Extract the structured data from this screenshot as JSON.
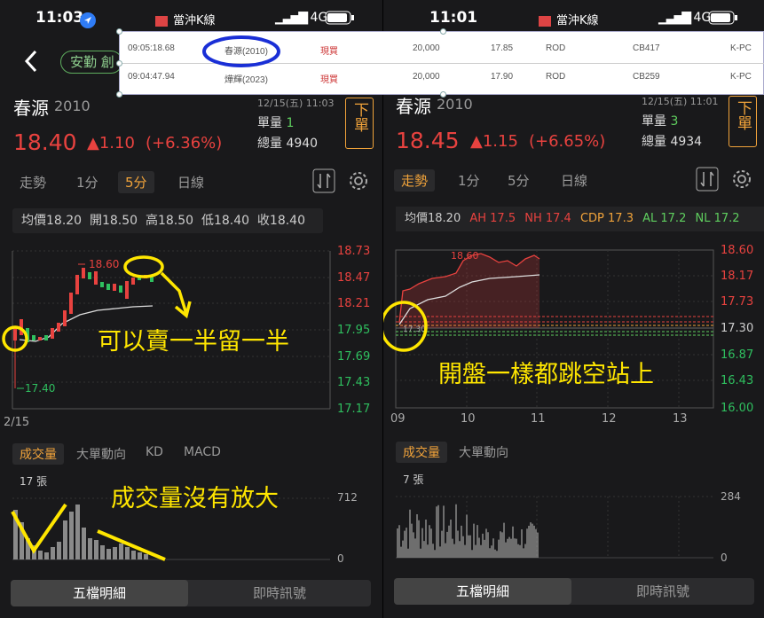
{
  "left": {
    "status_time": "11:03",
    "stock_name": "春源",
    "stock_code": "2010",
    "datetime": "12/15(五) 11:03",
    "unit_label": "單量",
    "unit_value": "1",
    "total_label": "總量",
    "total_value": "4940",
    "price": "18.40",
    "change": "▲1.10",
    "change_pct": "(+6.36%)",
    "order_button": "下單",
    "back_chip": "安勤 創",
    "tabs": [
      "走勢",
      "1分",
      "5分",
      "日線"
    ],
    "active_tab": "5分",
    "stats": "均價18.20  開18.50  高18.50  低18.40  收18.40",
    "y_ticks": [
      "18.73",
      "18.47",
      "18.21",
      "17.95",
      "17.69",
      "17.43",
      "17.17"
    ],
    "x_tick": "2/15",
    "high_label": "18.60",
    "low_label": "17.40",
    "indicator_tabs": [
      "成交量",
      "大單動向",
      "KD",
      "MACD"
    ],
    "vol_count": "17 張",
    "vol_max": "712",
    "vol_min": "0",
    "note1": "可以賣一半留一半",
    "note2": "成交量沒有放大",
    "bottom_tabs": [
      "五檔明細",
      "即時訊號"
    ]
  },
  "right": {
    "status_time": "11:01",
    "stock_name": "春源",
    "stock_code": "2010",
    "datetime": "12/15(五) 11:01",
    "unit_label": "單量",
    "unit_value": "3",
    "total_label": "總量",
    "total_value": "4934",
    "price": "18.45",
    "change": "▲1.15",
    "change_pct": "(+6.65%)",
    "order_button": "下單",
    "tabs": [
      "走勢",
      "1分",
      "5分",
      "日線"
    ],
    "active_tab": "走勢",
    "stats": {
      "avg": "均價18.20",
      "ah": "AH 17.5",
      "nh": "NH 17.4",
      "cdp": "CDP 17.3",
      "al": "AL 17.2",
      "nl": "NL 17.2"
    },
    "y_ticks": [
      "18.60",
      "18.17",
      "17.73",
      "17.30",
      "16.87",
      "16.43",
      "16.00"
    ],
    "x_ticks": [
      "09",
      "10",
      "11",
      "12",
      "13"
    ],
    "peak_label": "18.60",
    "open_label": "17.30",
    "indicator_tabs": [
      "成交量",
      "大單動向"
    ],
    "vol_count": "7 張",
    "vol_max": "284",
    "vol_min": "0",
    "note": "開盤一樣都跳空站上",
    "bottom_tabs": [
      "五檔明細",
      "即時訊號"
    ]
  },
  "status_app": "當沖K線",
  "status_network": "4G",
  "overlay_table": [
    {
      "time": "09:05:18.68",
      "stock": "春源(2010)",
      "type": "現買",
      "qty": "20,000",
      "price": "17.85",
      "order": "ROD",
      "code": "CB417",
      "src": "K-PC"
    },
    {
      "time": "09:04:47.94",
      "stock": "燁輝(2023)",
      "type": "現買",
      "qty": "20,000",
      "price": "17.90",
      "order": "ROD",
      "code": "CB259",
      "src": "K-PC"
    }
  ],
  "colors": {
    "red": "#e8423f",
    "accent": "#f1a33a",
    "annotation": "#ffe600",
    "highlight_circle": "#1a2fd6"
  }
}
